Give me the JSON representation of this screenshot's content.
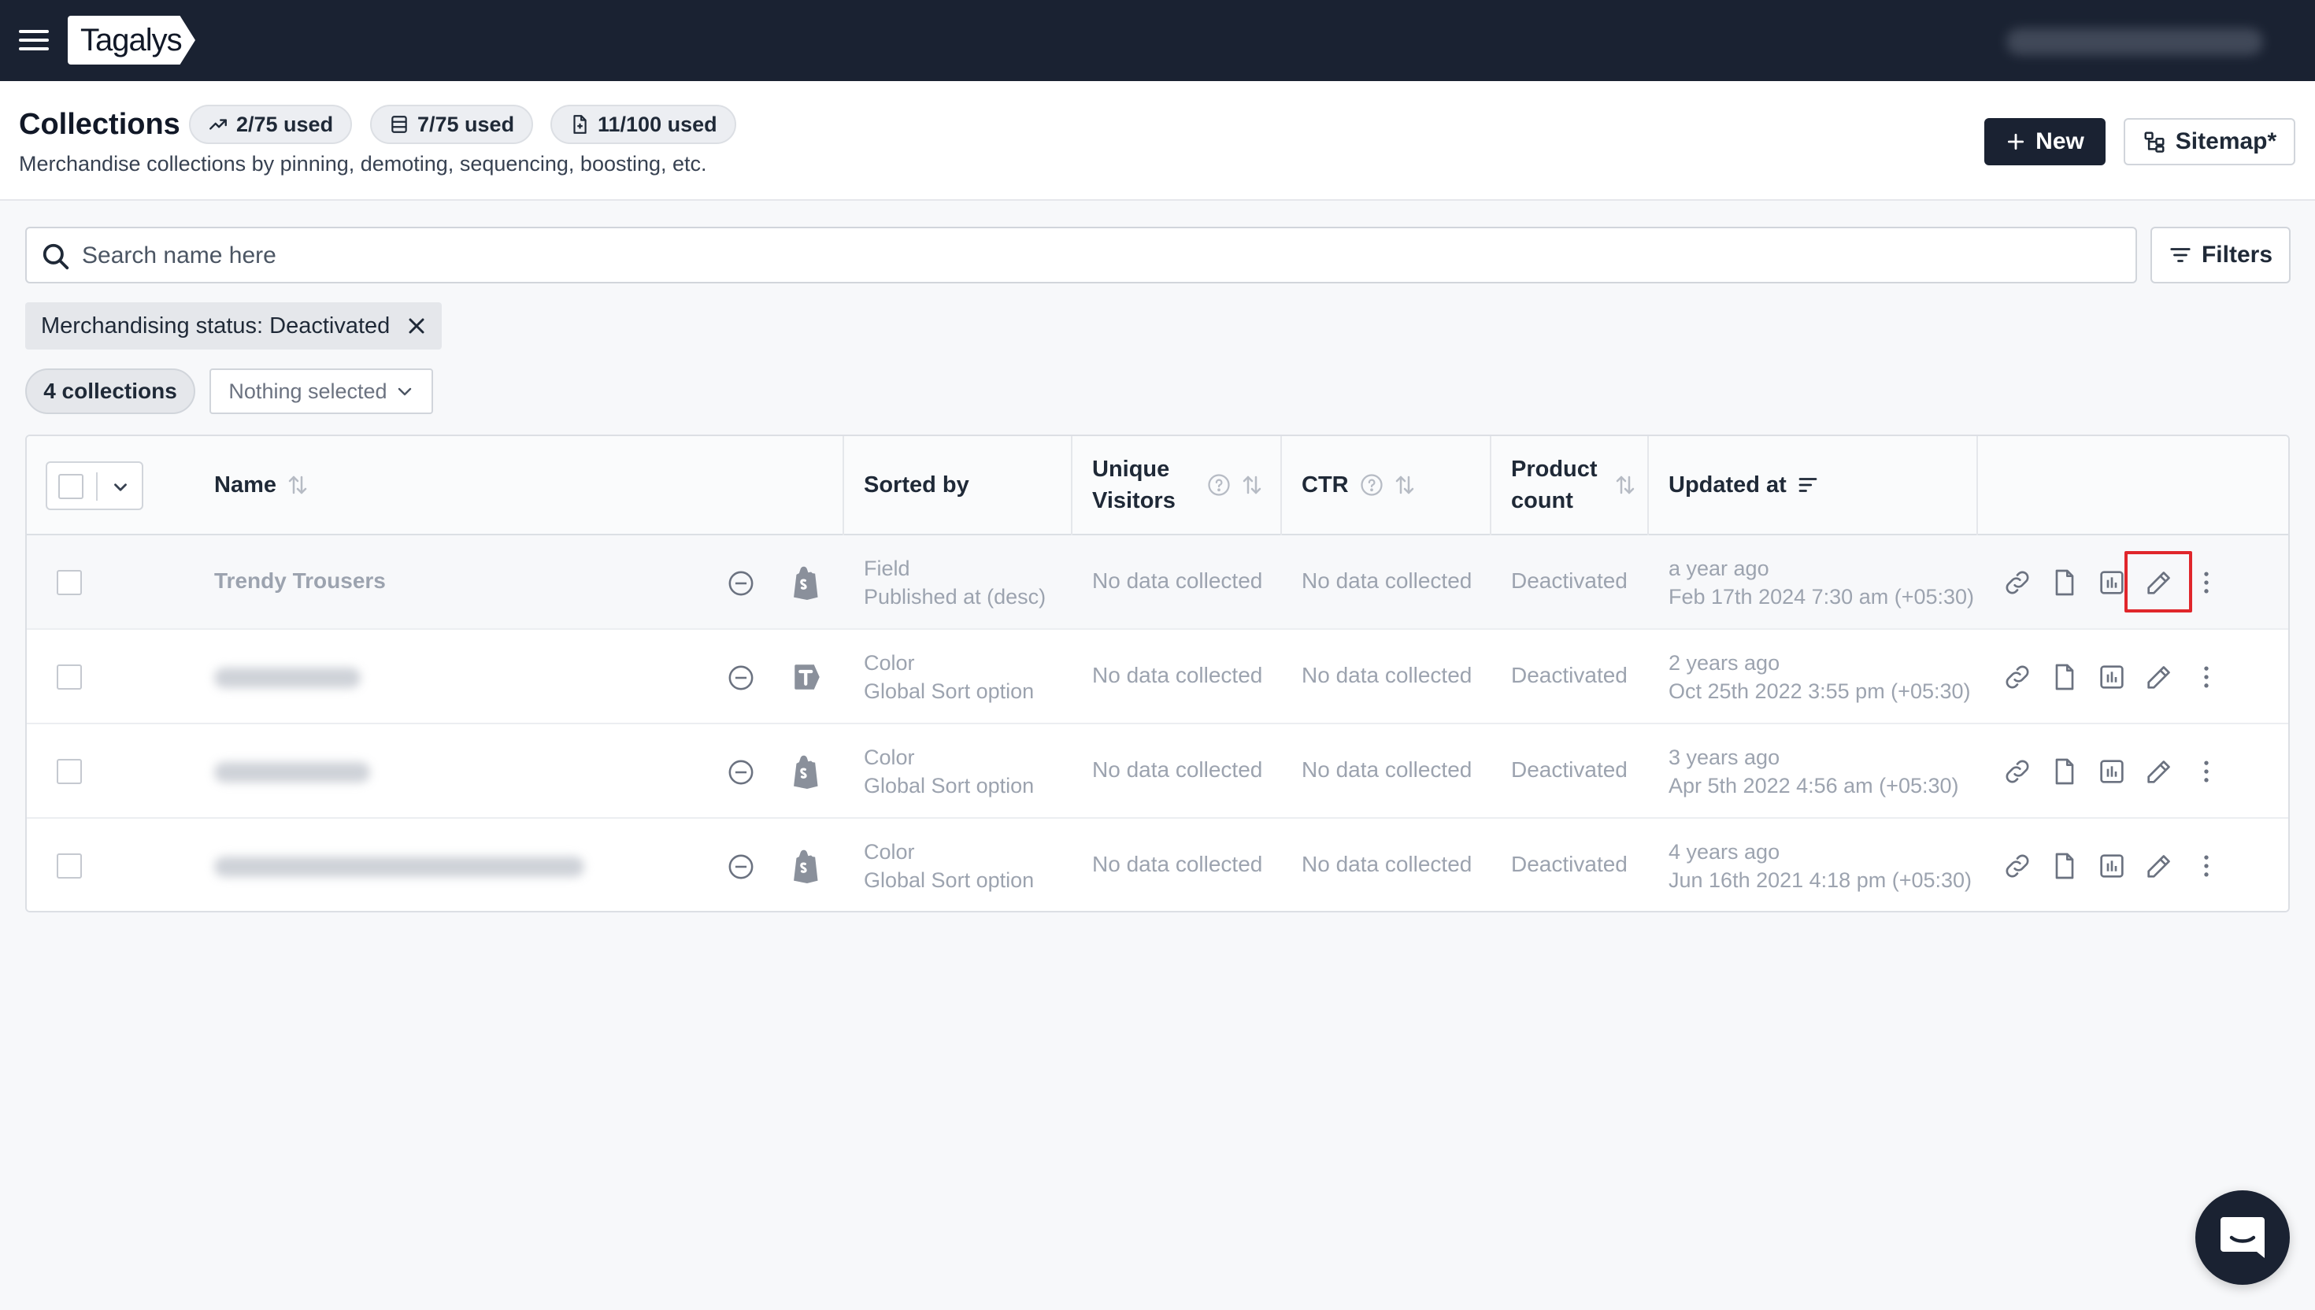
{
  "app": {
    "logo_text": "Tagalys"
  },
  "header": {
    "title": "Collections",
    "usage": [
      {
        "icon": "trend-up-icon",
        "label": "2/75 used"
      },
      {
        "icon": "database-icon",
        "label": "7/75 used"
      },
      {
        "icon": "file-icon",
        "label": "11/100 used"
      }
    ],
    "subtitle": "Merchandise collections by pinning, demoting, sequencing, boosting, etc.",
    "new_label": "New",
    "sitemap_label": "Sitemap*"
  },
  "search": {
    "placeholder": "Search name here",
    "value": ""
  },
  "filters_label": "Filters",
  "active_filter": "Merchandising status: Deactivated",
  "collection_count": "4 collections",
  "bulk_select": "Nothing selected",
  "table": {
    "columns": {
      "name": "Name",
      "sorted_by": "Sorted by",
      "unique_visitors": "Unique Visitors",
      "ctr": "CTR",
      "product_count": "Product count",
      "updated_at": "Updated at"
    },
    "rows": [
      {
        "name": "Trendy Trousers",
        "name_blurred": false,
        "source": "shopify-icon",
        "sort_type": "Field",
        "sort_detail": "Published at (desc)",
        "visitors": "No data collected",
        "ctr": "No data collected",
        "product_count": "Deactivated",
        "updated_rel": "a year ago",
        "updated_abs": "Feb 17th 2024 7:30 am (+05:30)"
      },
      {
        "name": "",
        "name_blurred": true,
        "source": "tagalys-icon",
        "sort_type": "Color",
        "sort_detail": "Global Sort option",
        "visitors": "No data collected",
        "ctr": "No data collected",
        "product_count": "Deactivated",
        "updated_rel": "2 years ago",
        "updated_abs": "Oct 25th 2022 3:55 pm (+05:30)"
      },
      {
        "name": "",
        "name_blurred": true,
        "source": "shopify-icon",
        "sort_type": "Color",
        "sort_detail": "Global Sort option",
        "visitors": "No data collected",
        "ctr": "No data collected",
        "product_count": "Deactivated",
        "updated_rel": "3 years ago",
        "updated_abs": "Apr 5th 2022 4:56 am (+05:30)"
      },
      {
        "name": "",
        "name_blurred": true,
        "source": "shopify-icon",
        "sort_type": "Color",
        "sort_detail": "Global Sort option",
        "visitors": "No data collected",
        "ctr": "No data collected",
        "product_count": "Deactivated",
        "updated_rel": "4 years ago",
        "updated_abs": "Jun 16th 2021 4:18 pm (+05:30)"
      }
    ]
  },
  "colors": {
    "topbar": "#1a2232",
    "highlight": "#e0262b",
    "muted_text": "#9ca3af"
  }
}
